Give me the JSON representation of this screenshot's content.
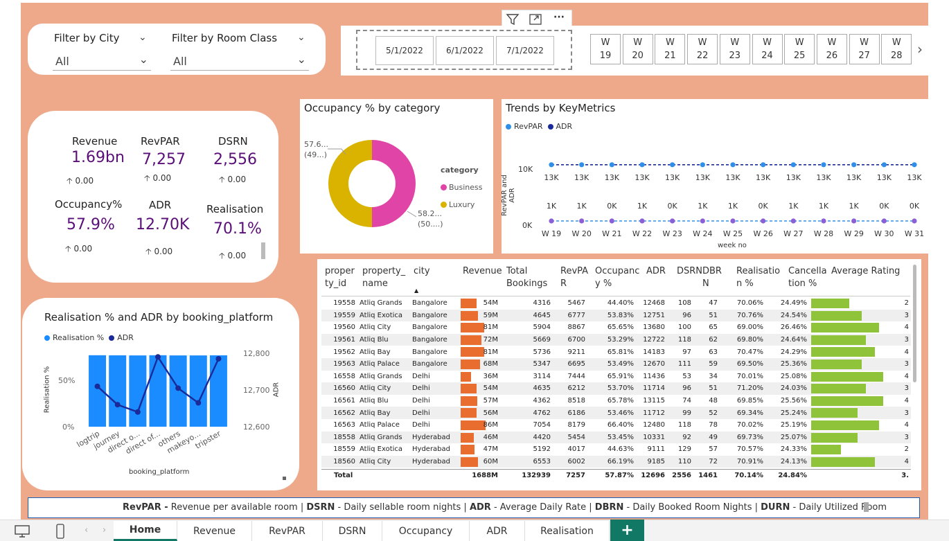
{
  "filters": {
    "city_label": "Filter by City",
    "city_value": "All",
    "room_label": "Filter by Room Class",
    "room_value": "All"
  },
  "visual_header": {
    "filter_icon": "filter-icon",
    "focus_icon": "focus-mode-icon",
    "more_icon": "more-options-icon",
    "more_label": "···"
  },
  "dates": [
    "5/1/2022",
    "6/1/2022",
    "7/1/2022"
  ],
  "weeks": [
    {
      "w": "W",
      "n": "19"
    },
    {
      "w": "W",
      "n": "20"
    },
    {
      "w": "W",
      "n": "21"
    },
    {
      "w": "W",
      "n": "22"
    },
    {
      "w": "W",
      "n": "23"
    },
    {
      "w": "W",
      "n": "24"
    },
    {
      "w": "W",
      "n": "25"
    },
    {
      "w": "W",
      "n": "26"
    },
    {
      "w": "W",
      "n": "27"
    },
    {
      "w": "W",
      "n": "28"
    }
  ],
  "week_next": "›",
  "kpis": {
    "revenue": {
      "name": "Revenue",
      "value": "1.69bn",
      "delta": "0.00"
    },
    "revpar": {
      "name": "RevPAR",
      "value": "7,257",
      "delta": "0.00"
    },
    "dsrn": {
      "name": "DSRN",
      "value": "2,556",
      "delta": "0.00"
    },
    "occupancy": {
      "name": "Occupancy%",
      "value": "57.9%",
      "delta": "0.00"
    },
    "adr": {
      "name": "ADR",
      "value": "12.70K",
      "delta": "0.00"
    },
    "realisation": {
      "name": "Realisation",
      "value": "70.1%",
      "delta": "0.00"
    },
    "up_arrow": "🡡"
  },
  "occupancy_chart": {
    "title": "Occupancy % by category",
    "legend_title": "category",
    "label_business": [
      "58.2...",
      "(50....)"
    ],
    "label_luxury": [
      "57.6...",
      "(49...)"
    ],
    "colors": {
      "business": "#e044a7",
      "luxury": "#d9b300"
    }
  },
  "trends_chart": {
    "title": "Trends by KeyMetrics",
    "ylabel": "RevPAR and ADR",
    "xlabel": "week no",
    "yticks": [
      "10K",
      "0K"
    ]
  },
  "realisation_chart": {
    "title": "Realisation % and ADR by booking_platform",
    "ylabel_left": "Realisation %",
    "ylabel_right": "ADR",
    "xlabel": "booking_platform",
    "yticks_left": [
      "50%",
      "0%"
    ],
    "yticks_right": [
      "12,800",
      "12,700",
      "12,600"
    ],
    "xticks": [
      "logtrip",
      "journey",
      "direct o...",
      "direct of...",
      "others",
      "makeyo...",
      "tripster"
    ]
  },
  "chart_data": [
    {
      "type": "pie",
      "title": "Occupancy % by category",
      "categories": [
        "Business",
        "Luxury"
      ],
      "values": [
        50.3,
        49.7
      ],
      "data_labels": [
        "58.2...",
        "57.6..."
      ]
    },
    {
      "type": "line",
      "title": "Trends by KeyMetrics",
      "xlabel": "week no",
      "ylabel": "RevPAR and ADR",
      "categories": [
        "W 19",
        "W 20",
        "W 21",
        "W 22",
        "W 23",
        "W 24",
        "W 25",
        "W 26",
        "W 27",
        "W 28",
        "W 29",
        "W 30",
        "W 31"
      ],
      "series": [
        {
          "name": "RevPAR",
          "color": "#2f8fe8",
          "values": [
            13000,
            13000,
            13000,
            13000,
            13000,
            13000,
            13000,
            13000,
            13000,
            13000,
            13000,
            13000,
            13000
          ],
          "labels": [
            "13K",
            "13K",
            "13K",
            "13K",
            "13K",
            "13K",
            "13K",
            "13K",
            "13K",
            "13K",
            "13K",
            "13K",
            "13K"
          ]
        },
        {
          "name": "ADR",
          "color": "#1a2a99",
          "values": [
            1000,
            1000,
            0,
            1000,
            0,
            1000,
            1000,
            0,
            1000,
            1000,
            1000,
            0,
            0
          ],
          "labels": [
            "1K",
            "1K",
            "0K",
            "1K",
            "0K",
            "1K",
            "1K",
            "0K",
            "1K",
            "1K",
            "1K",
            "0K",
            "0K"
          ]
        }
      ],
      "ylim": [
        0,
        15000
      ]
    },
    {
      "type": "bar",
      "title": "Realisation % and ADR by booking_platform",
      "xlabel": "booking_platform",
      "categories": [
        "logtrip",
        "journey",
        "direct o...",
        "direct of...",
        "others",
        "makeyo...",
        "tripster"
      ],
      "series": [
        {
          "name": "Realisation %",
          "color": "#1a8cff",
          "values": [
            70.2,
            70.1,
            70.0,
            70.2,
            70.0,
            70.0,
            70.1
          ],
          "axis": "left",
          "ylim": [
            0,
            75
          ]
        },
        {
          "name": "ADR",
          "color": "#1a2a99",
          "values": [
            12710,
            12660,
            12640,
            12790,
            12705,
            12665,
            12785
          ],
          "axis": "right",
          "ylim": [
            12580,
            12820
          ]
        }
      ]
    }
  ],
  "table": {
    "headers": [
      "proper ty_id",
      "property_ name",
      "city",
      "Revenue",
      "Total Bookings",
      "RevPA R",
      "Occupanc y %",
      "ADR",
      "DSRN",
      "DBR N",
      "Realisatio n %",
      "Cancella tion %",
      "Average Rating"
    ],
    "rows": [
      [
        "19558",
        "Atliq Grands",
        "Bangalore",
        "54M",
        "4316",
        "5467",
        "44.40%",
        "12468",
        "108",
        "47",
        "70.06%",
        "24.49%",
        "2"
      ],
      [
        "19559",
        "Atliq Exotica",
        "Bangalore",
        "59M",
        "4645",
        "6777",
        "53.83%",
        "12751",
        "96",
        "51",
        "70.76%",
        "24.54%",
        "3"
      ],
      [
        "19560",
        "Atliq City",
        "Bangalore",
        "81M",
        "5904",
        "8867",
        "65.65%",
        "13680",
        "100",
        "65",
        "69.00%",
        "26.46%",
        "4"
      ],
      [
        "19561",
        "Atliq Blu",
        "Bangalore",
        "72M",
        "5669",
        "6700",
        "53.29%",
        "12722",
        "118",
        "62",
        "69.80%",
        "24.64%",
        "3"
      ],
      [
        "19562",
        "Atliq Bay",
        "Bangalore",
        "81M",
        "5736",
        "9211",
        "65.81%",
        "14183",
        "97",
        "63",
        "70.47%",
        "24.29%",
        "4"
      ],
      [
        "19563",
        "Atliq Palace",
        "Bangalore",
        "68M",
        "5347",
        "6695",
        "53.49%",
        "12670",
        "111",
        "59",
        "69.50%",
        "25.36%",
        "3"
      ],
      [
        "16558",
        "Atliq Grands",
        "Delhi",
        "36M",
        "3114",
        "7444",
        "65.91%",
        "11436",
        "53",
        "34",
        "70.01%",
        "25.08%",
        "4"
      ],
      [
        "16560",
        "Atliq City",
        "Delhi",
        "54M",
        "4635",
        "6212",
        "53.70%",
        "11714",
        "96",
        "51",
        "71.20%",
        "24.03%",
        "3"
      ],
      [
        "16561",
        "Atliq Blu",
        "Delhi",
        "57M",
        "4362",
        "8518",
        "65.78%",
        "13115",
        "74",
        "48",
        "69.85%",
        "25.56%",
        "4"
      ],
      [
        "16562",
        "Atliq Bay",
        "Delhi",
        "56M",
        "4762",
        "6186",
        "53.46%",
        "11712",
        "99",
        "52",
        "69.34%",
        "25.24%",
        "3"
      ],
      [
        "16563",
        "Atliq Palace",
        "Delhi",
        "86M",
        "7054",
        "8179",
        "66.40%",
        "12480",
        "118",
        "78",
        "70.02%",
        "25.19%",
        "4"
      ],
      [
        "18558",
        "Atliq Grands",
        "Hyderabad",
        "46M",
        "4420",
        "5454",
        "53.45%",
        "10331",
        "92",
        "49",
        "69.73%",
        "25.07%",
        "3"
      ],
      [
        "18559",
        "Atliq Exotica",
        "Hyderabad",
        "47M",
        "5192",
        "4017",
        "44.63%",
        "9111",
        "129",
        "57",
        "70.57%",
        "24.33%",
        "2"
      ],
      [
        "18560",
        "Atliq City",
        "Hyderabad",
        "60M",
        "6553",
        "6002",
        "66.19%",
        "9185",
        "110",
        "72",
        "70.91%",
        "24.13%",
        "4"
      ]
    ],
    "revenue_values": [
      54,
      59,
      81,
      72,
      81,
      68,
      36,
      54,
      57,
      56,
      86,
      46,
      47,
      60
    ],
    "rating_values": [
      3.5,
      3.8,
      4.2,
      3.9,
      4.1,
      3.8,
      4.3,
      3.9,
      4.3,
      3.7,
      4.2,
      3.7,
      3.3,
      4.1
    ],
    "total": [
      "Total",
      "",
      "",
      "1688M",
      "132939",
      "7257",
      "57.87%",
      "12696",
      "2556",
      "1461",
      "70.14%",
      "24.84%",
      "3."
    ]
  },
  "glossary": {
    "k1": "RevPAR -",
    "v1": " Revenue per available room | ",
    "k2": "DSRN",
    "v2": " - Daily sellable room nights | ",
    "k3": "ADR",
    "v3": " - Average Daily Rate | ",
    "k4": "DBRN",
    "v4": " - Daily Booked Room Nights | ",
    "k5": "DURN",
    "v5": " - Daily Utilized Room"
  },
  "tabs": [
    "Home",
    "Revenue",
    "RevPAR",
    "DSRN",
    "Occupancy",
    "ADR",
    "Realisation"
  ],
  "add_tab": "+"
}
